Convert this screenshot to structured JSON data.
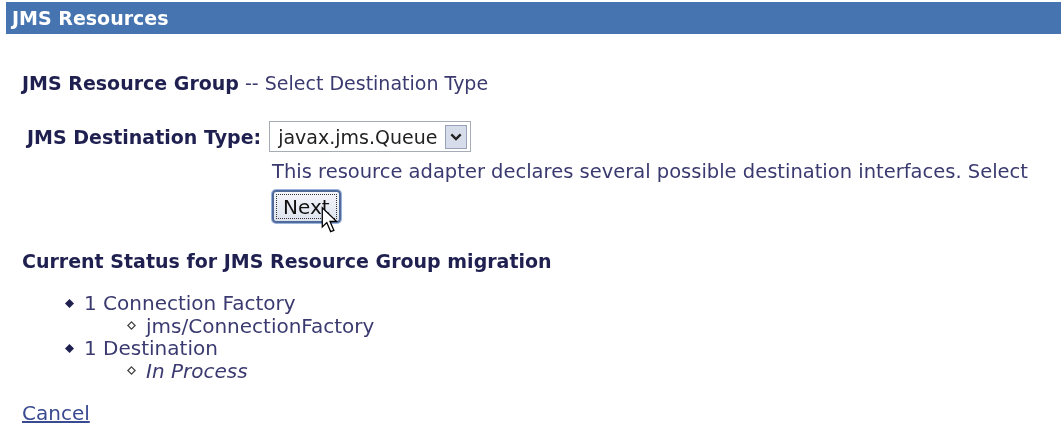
{
  "header": {
    "title": "JMS Resources"
  },
  "heading": {
    "bold": "JMS Resource Group",
    "rest": "-- Select Destination Type"
  },
  "destination_type": {
    "label": "JMS Destination Type:",
    "value": "javax.jms.Queue",
    "description": "This resource adapter declares several possible destination interfaces. Select"
  },
  "next_button": {
    "label": "Next",
    "focused": true
  },
  "status": {
    "title": "Current Status for JMS Resource Group migration",
    "items": [
      {
        "label": "1 Connection Factory",
        "children": [
          {
            "label": "jms/ConnectionFactory",
            "italic": false
          }
        ]
      },
      {
        "label": "1 Destination",
        "children": [
          {
            "label": "In Process",
            "italic": true
          }
        ]
      }
    ]
  },
  "cancel_link": "Cancel"
}
